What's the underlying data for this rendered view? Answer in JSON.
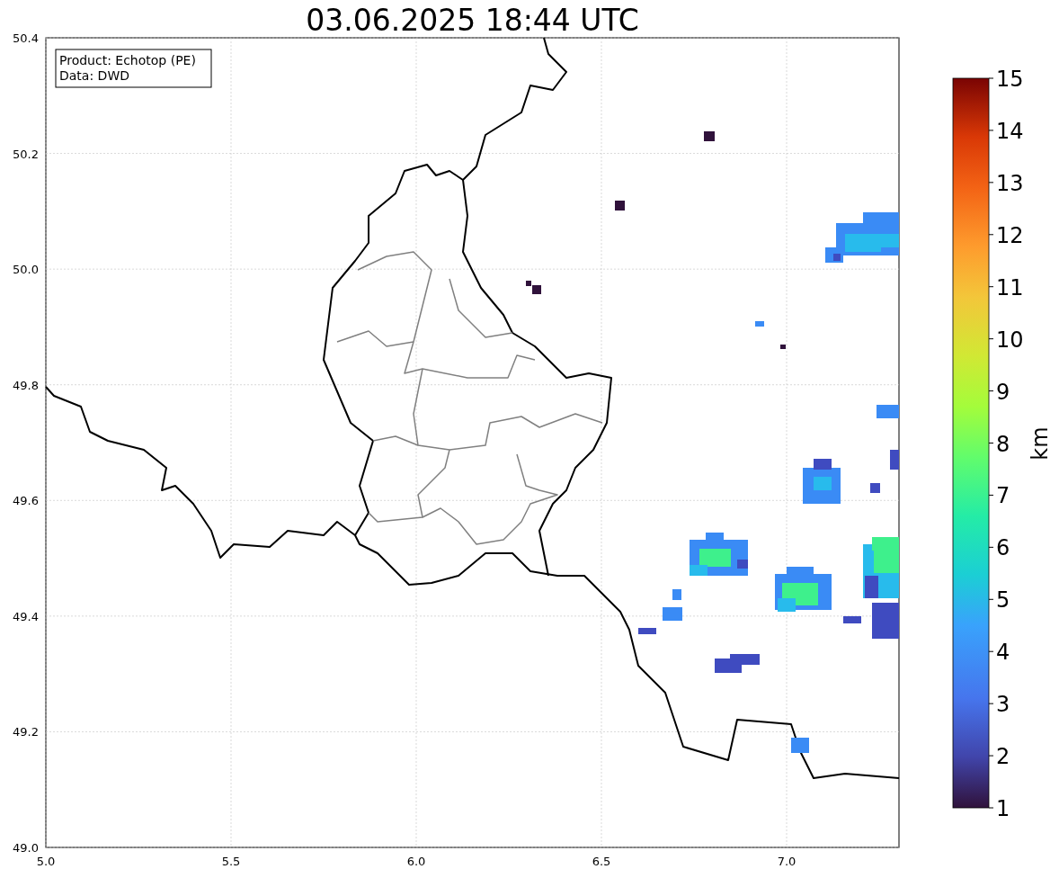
{
  "title": "03.06.2025 18:44 UTC",
  "info_box": [
    "Product: Echotop (PE)",
    "Data: DWD"
  ],
  "map": {
    "xticks": [
      "5.0",
      "5.5",
      "6.0",
      "6.5",
      "7.0"
    ],
    "yticks": [
      "50.4",
      "50.2",
      "50.0",
      "49.8",
      "49.6",
      "49.4",
      "49.2",
      "49.0"
    ]
  },
  "colorbar": {
    "label": "km",
    "ticks": [
      "15",
      "14",
      "13",
      "12",
      "11",
      "10",
      "9",
      "8",
      "7",
      "6",
      "5",
      "4",
      "3",
      "2",
      "1"
    ]
  }
}
